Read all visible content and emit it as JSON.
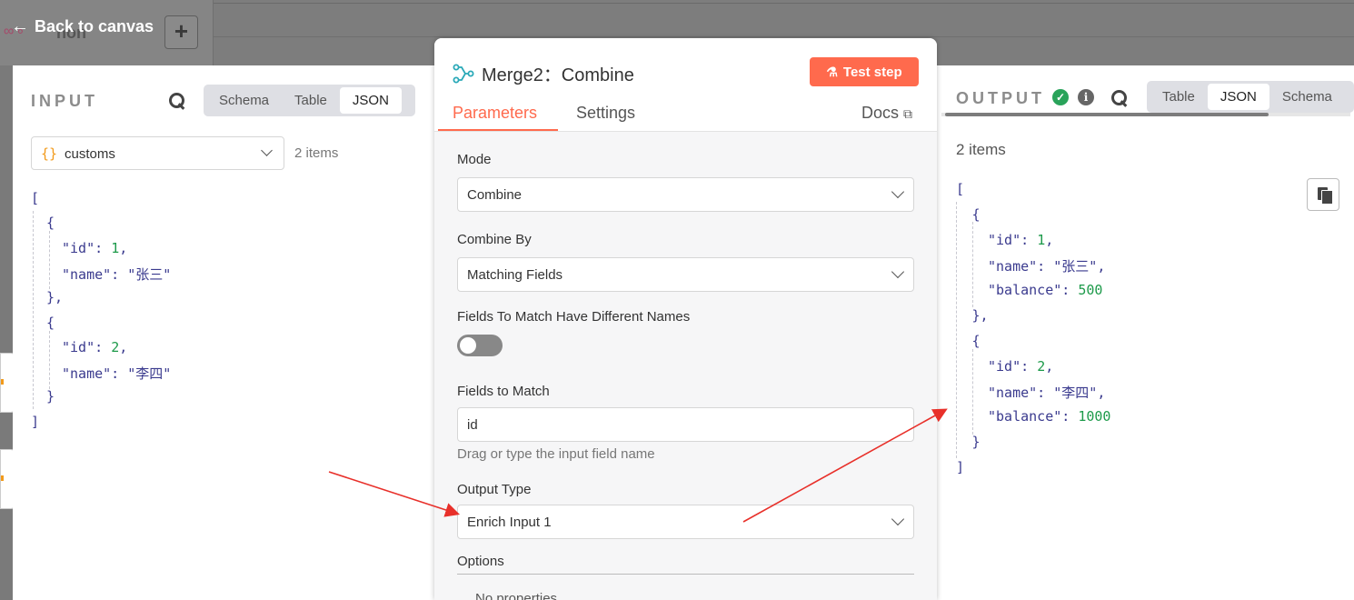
{
  "header": {
    "back_label": "Back to canvas",
    "workflow_name": "non",
    "add_label": "+"
  },
  "input_panel": {
    "title": "INPUT",
    "view_tabs": [
      "Schema",
      "Table",
      "JSON"
    ],
    "active_view": "JSON",
    "source_node": "customs",
    "item_count": "2 items",
    "json_lines": [
      {
        "text": "[",
        "indent": 0
      },
      {
        "text": "{",
        "indent": 1
      },
      {
        "key": "\"id\"",
        "value": "1",
        "type": "num",
        "trail": ",",
        "indent": 2
      },
      {
        "key": "\"name\"",
        "value": "\"张三\"",
        "type": "str",
        "trail": "",
        "indent": 2
      },
      {
        "text": "},",
        "indent": 1
      },
      {
        "text": "{",
        "indent": 1
      },
      {
        "key": "\"id\"",
        "value": "2",
        "type": "num",
        "trail": ",",
        "indent": 2
      },
      {
        "key": "\"name\"",
        "value": "\"李四\"",
        "type": "str",
        "trail": "",
        "indent": 2
      },
      {
        "text": "}",
        "indent": 1
      },
      {
        "text": "]",
        "indent": 0
      }
    ]
  },
  "node_panel": {
    "title": "Merge2：Combine",
    "test_button": "Test step",
    "tabs": [
      "Parameters",
      "Settings"
    ],
    "active_tab": "Parameters",
    "docs_label": "Docs",
    "fields": {
      "mode_label": "Mode",
      "mode_value": "Combine",
      "combine_by_label": "Combine By",
      "combine_by_value": "Matching Fields",
      "different_names_label": "Fields To Match Have Different Names",
      "different_names_on": false,
      "fields_to_match_label": "Fields to Match",
      "fields_to_match_value": "id",
      "fields_to_match_hint": "Drag or type the input field name",
      "output_type_label": "Output Type",
      "output_type_value": "Enrich Input 1",
      "options_label": "Options",
      "no_properties": "No properties"
    }
  },
  "output_panel": {
    "title": "OUTPUT",
    "view_tabs": [
      "Table",
      "JSON",
      "Schema"
    ],
    "active_view": "JSON",
    "item_count": "2 items",
    "json_lines": [
      {
        "text": "[",
        "indent": 0
      },
      {
        "text": "{",
        "indent": 1
      },
      {
        "key": "\"id\"",
        "value": "1",
        "type": "num",
        "trail": ",",
        "indent": 2
      },
      {
        "key": "\"name\"",
        "value": "\"张三\"",
        "type": "str",
        "trail": ",",
        "indent": 2
      },
      {
        "key": "\"balance\"",
        "value": "500",
        "type": "num",
        "trail": "",
        "indent": 2
      },
      {
        "text": "},",
        "indent": 1
      },
      {
        "text": "{",
        "indent": 1
      },
      {
        "key": "\"id\"",
        "value": "2",
        "type": "num",
        "trail": ",",
        "indent": 2
      },
      {
        "key": "\"name\"",
        "value": "\"李四\"",
        "type": "str",
        "trail": ",",
        "indent": 2
      },
      {
        "key": "\"balance\"",
        "value": "1000",
        "type": "num",
        "trail": "",
        "indent": 2
      },
      {
        "text": "}",
        "indent": 1
      },
      {
        "text": "]",
        "indent": 0
      }
    ]
  },
  "colors": {
    "accent": "#ff6a4d",
    "success": "#29a35a",
    "json_number": "#1d9a4a",
    "json_string": "#3a3a8e"
  }
}
